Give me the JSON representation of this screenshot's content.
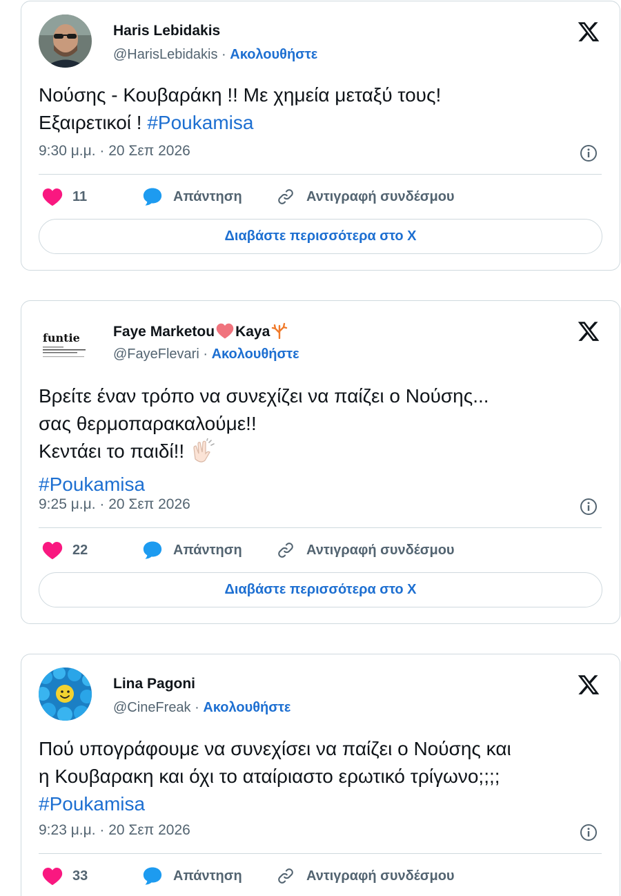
{
  "tweets": [
    {
      "author_name": "Haris Lebidakis",
      "handle": "@HarisLebidakis",
      "follow_label": "Ακολουθήστε",
      "text_lines": [
        "Νούσης - Κουβαράκη !! Με χημεία μεταξύ τους!",
        "Εξαιρετικοί ! "
      ],
      "hashtag": "#Poukamisa",
      "timestamp": "9:30 μ.μ. · 20 Σεπ 2026",
      "likes": "11",
      "reply_label": "Απάντηση",
      "copy_link_label": "Αντιγραφή συνδέσμου",
      "read_more_label": "Διαβάστε περισσότερα στο X"
    },
    {
      "author_name": "Faye Marketou",
      "author_name_suffix": "Kaya",
      "handle": "@FayeFlevari",
      "follow_label": "Ακολουθήστε",
      "text_lines": [
        "Βρείτε έναν τρόπο να συνεχίζει να παίζει ο Νούσης...",
        "σας θερμοπαρακαλούμε!!",
        "Κεντάει το παιδί!! "
      ],
      "hashtag": "#Poukamisa",
      "avatar_text": "funtie",
      "timestamp": "9:25 μ.μ. · 20 Σεπ 2026",
      "likes": "22",
      "reply_label": "Απάντηση",
      "copy_link_label": "Αντιγραφή συνδέσμου",
      "read_more_label": "Διαβάστε περισσότερα στο X"
    },
    {
      "author_name": "Lina Pagoni",
      "handle": "@CineFreak",
      "follow_label": "Ακολουθήστε",
      "text_lines": [
        "Πού υπογράφουμε να συνεχίσει να παίζει ο Νούσης και",
        "η Κουβαρακη και όχι το αταίριαστο ερωτικό τρίγωνο;;;;"
      ],
      "hashtag": "#Poukamisa",
      "timestamp": "9:23 μ.μ. · 20 Σεπ 2026",
      "likes": "33",
      "reply_label": "Απάντηση",
      "copy_link_label": "Αντιγραφή συνδέσμου"
    }
  ],
  "separator": " · ",
  "icons": [
    "x-logo-icon",
    "info-icon",
    "heart-icon",
    "reply-bubble-icon",
    "link-icon",
    "heart-emoji-icon",
    "coral-emoji-icon",
    "clapping-hands-icon"
  ],
  "colors": {
    "accent_blue": "#1d6fd1",
    "heart_pink": "#f91880",
    "reply_blue": "#1d9bf0",
    "muted_text": "#536471",
    "border": "#cfd9de"
  }
}
